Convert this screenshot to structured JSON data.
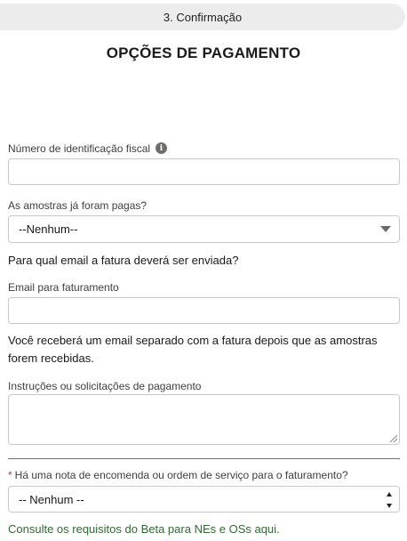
{
  "header": {
    "step_label": "3. Confirmação",
    "title": "OPÇÕES DE PAGAMENTO"
  },
  "form": {
    "tax_id": {
      "label": "Número de identificação fiscal",
      "info_icon": "info-icon",
      "value": ""
    },
    "samples_paid": {
      "label": "As amostras já foram pagas?",
      "selected": "--Nenhum--"
    },
    "invoice_email_question": "Para qual email a fatura deverá ser enviada?",
    "billing_email": {
      "label": "Email para faturamento",
      "value": ""
    },
    "invoice_note": "Você receberá um email separado com a fatura depois que as amostras forem recebidas.",
    "payment_instructions": {
      "label": "Instruções ou solicitações de pagamento",
      "value": ""
    },
    "purchase_order": {
      "required_marker": "*",
      "label": "Há uma nota de encomenda ou ordem de serviço para o faturamento?",
      "selected": "-- Nenhum --"
    },
    "requirements_link": "Consulte os requisitos do Beta para NEs e OSs aqui."
  },
  "colors": {
    "required": "#c23934",
    "link_green": "#2e6b2e",
    "step_bar_bg": "#ececec"
  }
}
